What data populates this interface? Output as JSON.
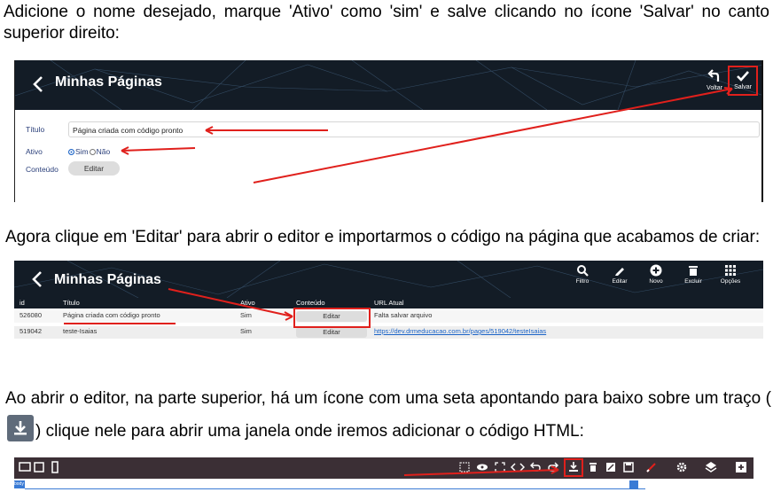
{
  "paragraphs": {
    "p1": "Adicione o nome desejado, marque 'Ativo' como 'sim' e salve clicando no ícone 'Salvar' no canto superior direito:",
    "p2": "Agora clique em 'Editar' para abrir o editor e importarmos o código na página que acabamos de criar:",
    "p3_before": "Ao abrir o editor, na parte superior, há um ícone com uma seta apontando para baixo sobre um traço (",
    "p3_after": ") clique nele para abrir uma janela onde iremos adicionar o código HTML:"
  },
  "shot1": {
    "title": "Minhas Páginas",
    "voltar_label": "Voltar",
    "salvar_label": "Salvar",
    "titulo_label": "Título",
    "titulo_value": "Página criada com código pronto",
    "ativo_label": "Ativo",
    "sim_label": "Sim",
    "nao_label": "Não",
    "conteudo_label": "Conteúdo",
    "editar_label": "Editar"
  },
  "shot2": {
    "title": "Minhas Páginas",
    "tools": [
      "Filtro",
      "Editar",
      "Novo",
      "Excluir",
      "Opções"
    ],
    "columns": [
      "id",
      "Título",
      "Ativo",
      "Conteúdo",
      "URL Atual"
    ],
    "rows": [
      {
        "id": "526080",
        "titulo": "Página criada com código pronto",
        "ativo": "Sim",
        "conteudo": "Editar",
        "url": "Falta salvar arquivo"
      },
      {
        "id": "519042",
        "titulo": "teste-Isaias",
        "ativo": "Sim",
        "conteudo": "Editar",
        "url": "https://dev.drmeducacao.com.br/pages/519042/testeIsaias"
      }
    ]
  },
  "shot3": {
    "body_tag": "body"
  },
  "colors": {
    "header_bg": "#131c26",
    "highlight_red": "#e0201c",
    "editor_bar": "#3b2f35",
    "accent_blue": "#1a63c7"
  }
}
